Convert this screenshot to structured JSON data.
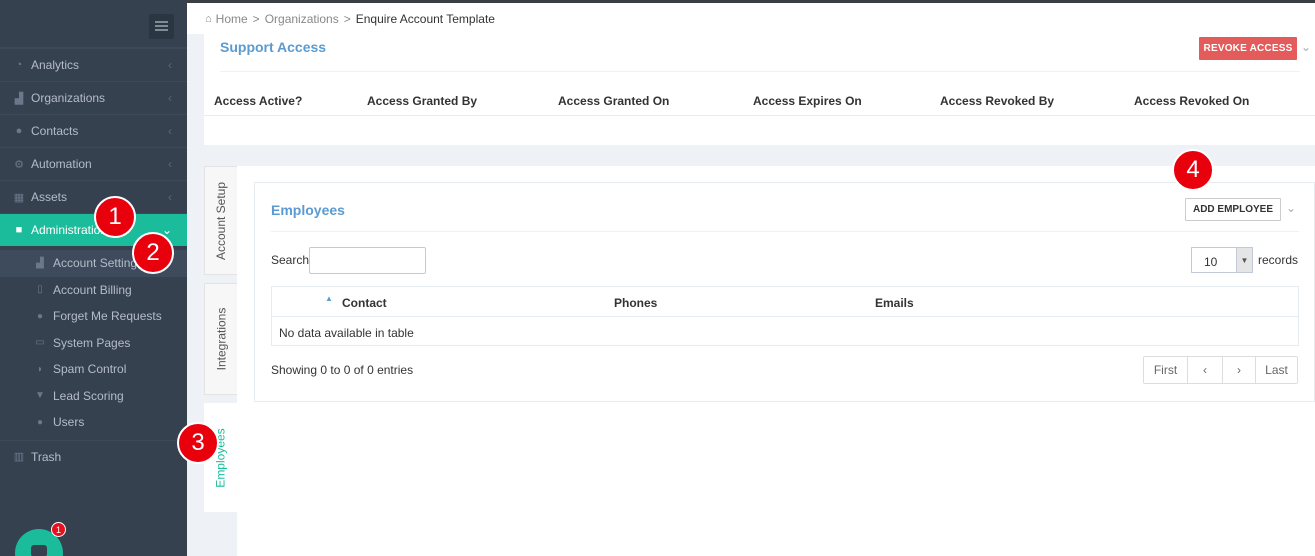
{
  "sidebar": {
    "menu_icon": "hamburger-icon",
    "items": [
      {
        "label": "Analytics",
        "icon": "dashboard-icon"
      },
      {
        "label": "Organizations",
        "icon": "sitemap-icon"
      },
      {
        "label": "Contacts",
        "icon": "users-icon"
      },
      {
        "label": "Automation",
        "icon": "cogs-icon"
      },
      {
        "label": "Assets",
        "icon": "grid-icon"
      },
      {
        "label": "Administration",
        "icon": "lock-icon"
      }
    ],
    "sub_items": [
      {
        "label": "Account Settings",
        "icon": "sitemap-icon"
      },
      {
        "label": "Account Billing",
        "icon": "file-icon"
      },
      {
        "label": "Forget Me Requests",
        "icon": "user-x-icon"
      },
      {
        "label": "System Pages",
        "icon": "window-icon"
      },
      {
        "label": "Spam Control",
        "icon": "shield-icon"
      },
      {
        "label": "Lead Scoring",
        "icon": "filter-icon"
      },
      {
        "label": "Users",
        "icon": "user-icon"
      }
    ],
    "trash_label": "Trash",
    "chat_badge": "1"
  },
  "breadcrumb": {
    "home": "Home",
    "sep1": ">",
    "organizations": "Organizations",
    "sep2": ">",
    "current": "Enquire Account Template"
  },
  "support_access": {
    "title": "Support Access",
    "revoke_button": "REVOKE ACCESS",
    "columns": [
      "Access Active?",
      "Access Granted By",
      "Access Granted On",
      "Access Expires On",
      "Access Revoked By",
      "Access Revoked On"
    ]
  },
  "vertical_tabs": [
    "Account Setup",
    "Integrations",
    "Employees"
  ],
  "employees": {
    "title": "Employees",
    "add_button": "ADD EMPLOYEE",
    "search_label": "Search:",
    "search_value": "",
    "page_length": "10",
    "records_label": "records",
    "columns": [
      "Contact",
      "Phones",
      "Emails"
    ],
    "empty_message": "No data available in table",
    "info": "Showing 0 to 0 of 0 entries",
    "pager": {
      "first": "First",
      "prev": "‹",
      "next": "›",
      "last": "Last"
    }
  },
  "markers": [
    "1",
    "2",
    "3",
    "4"
  ],
  "colors": {
    "sidebar_bg": "#364150",
    "active_green": "#1bbc9b",
    "title_blue": "#5b9bd1",
    "revoke_red": "#e35b5a",
    "marker_red": "#e8000d"
  }
}
